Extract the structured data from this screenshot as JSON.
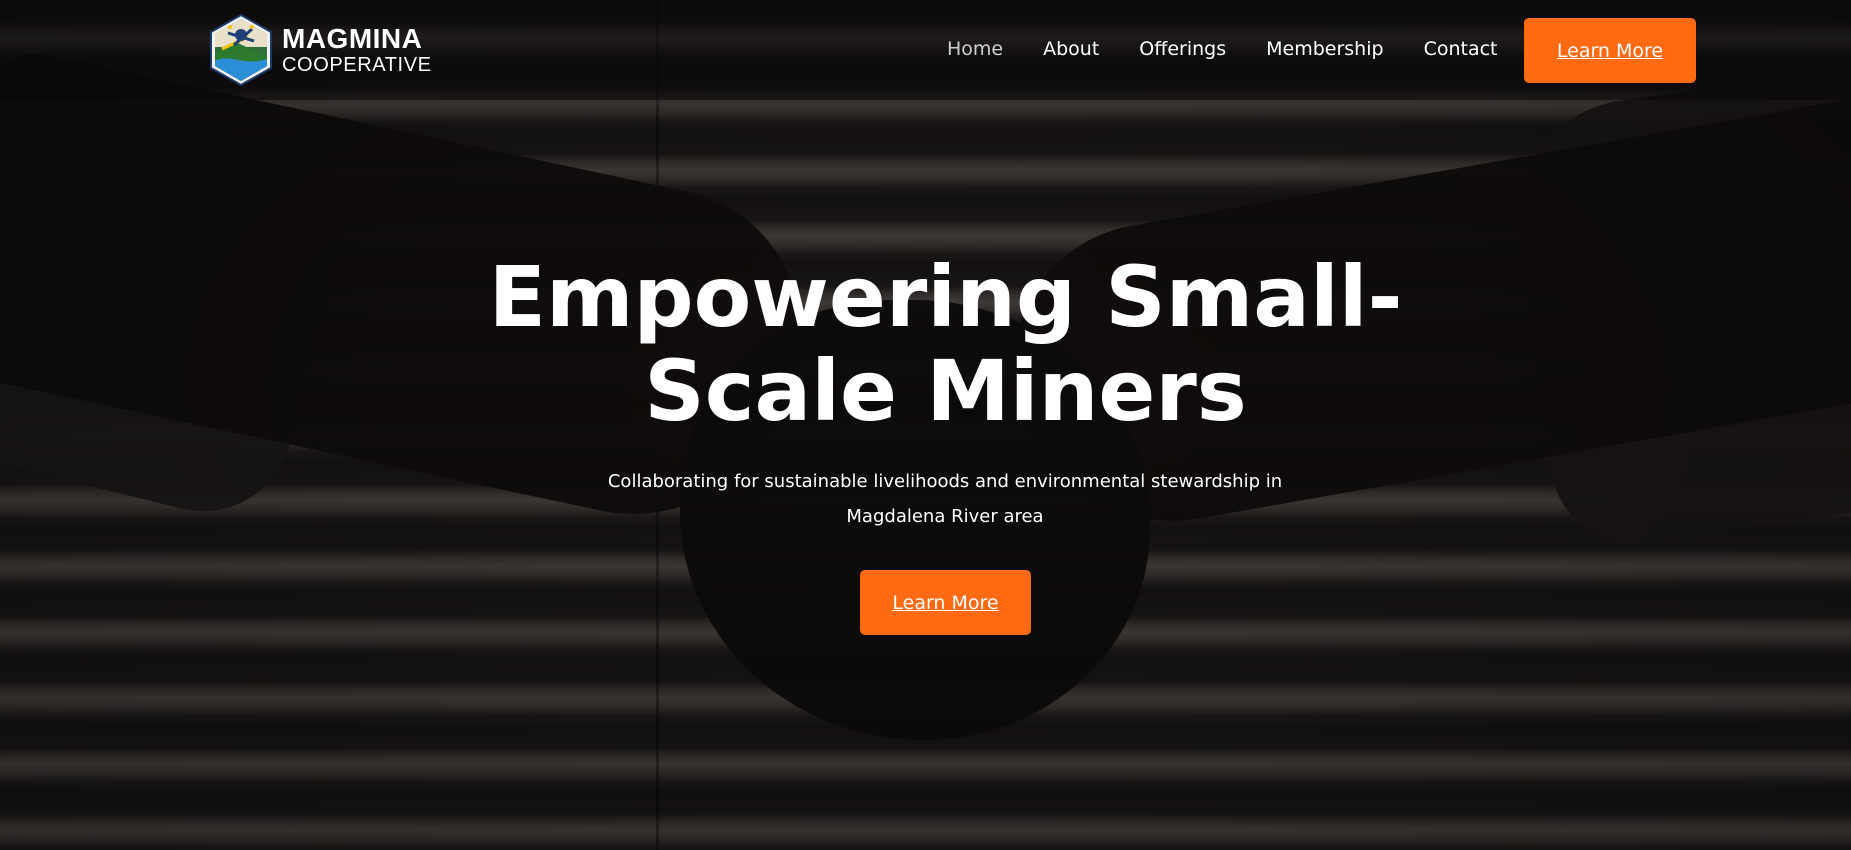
{
  "brand": {
    "name": "MAGMINA",
    "subtitle": "COOPERATIVE",
    "logo_icon": "hexagon-miner-logo-icon"
  },
  "nav": {
    "items": [
      {
        "label": "Home",
        "active": true
      },
      {
        "label": "About",
        "active": false
      },
      {
        "label": "Offerings",
        "active": false
      },
      {
        "label": "Membership",
        "active": false
      },
      {
        "label": "Contact",
        "active": false
      }
    ],
    "cta_label": "Learn More"
  },
  "hero": {
    "title": "Empowering Small-Scale Miners",
    "subtitle": "Collaborating for sustainable livelihoods and environmental stewardship in Magdalena River area",
    "cta_label": "Learn More"
  },
  "colors": {
    "accent": "#ff6a13",
    "text": "#ffffff",
    "background": "#171413"
  }
}
